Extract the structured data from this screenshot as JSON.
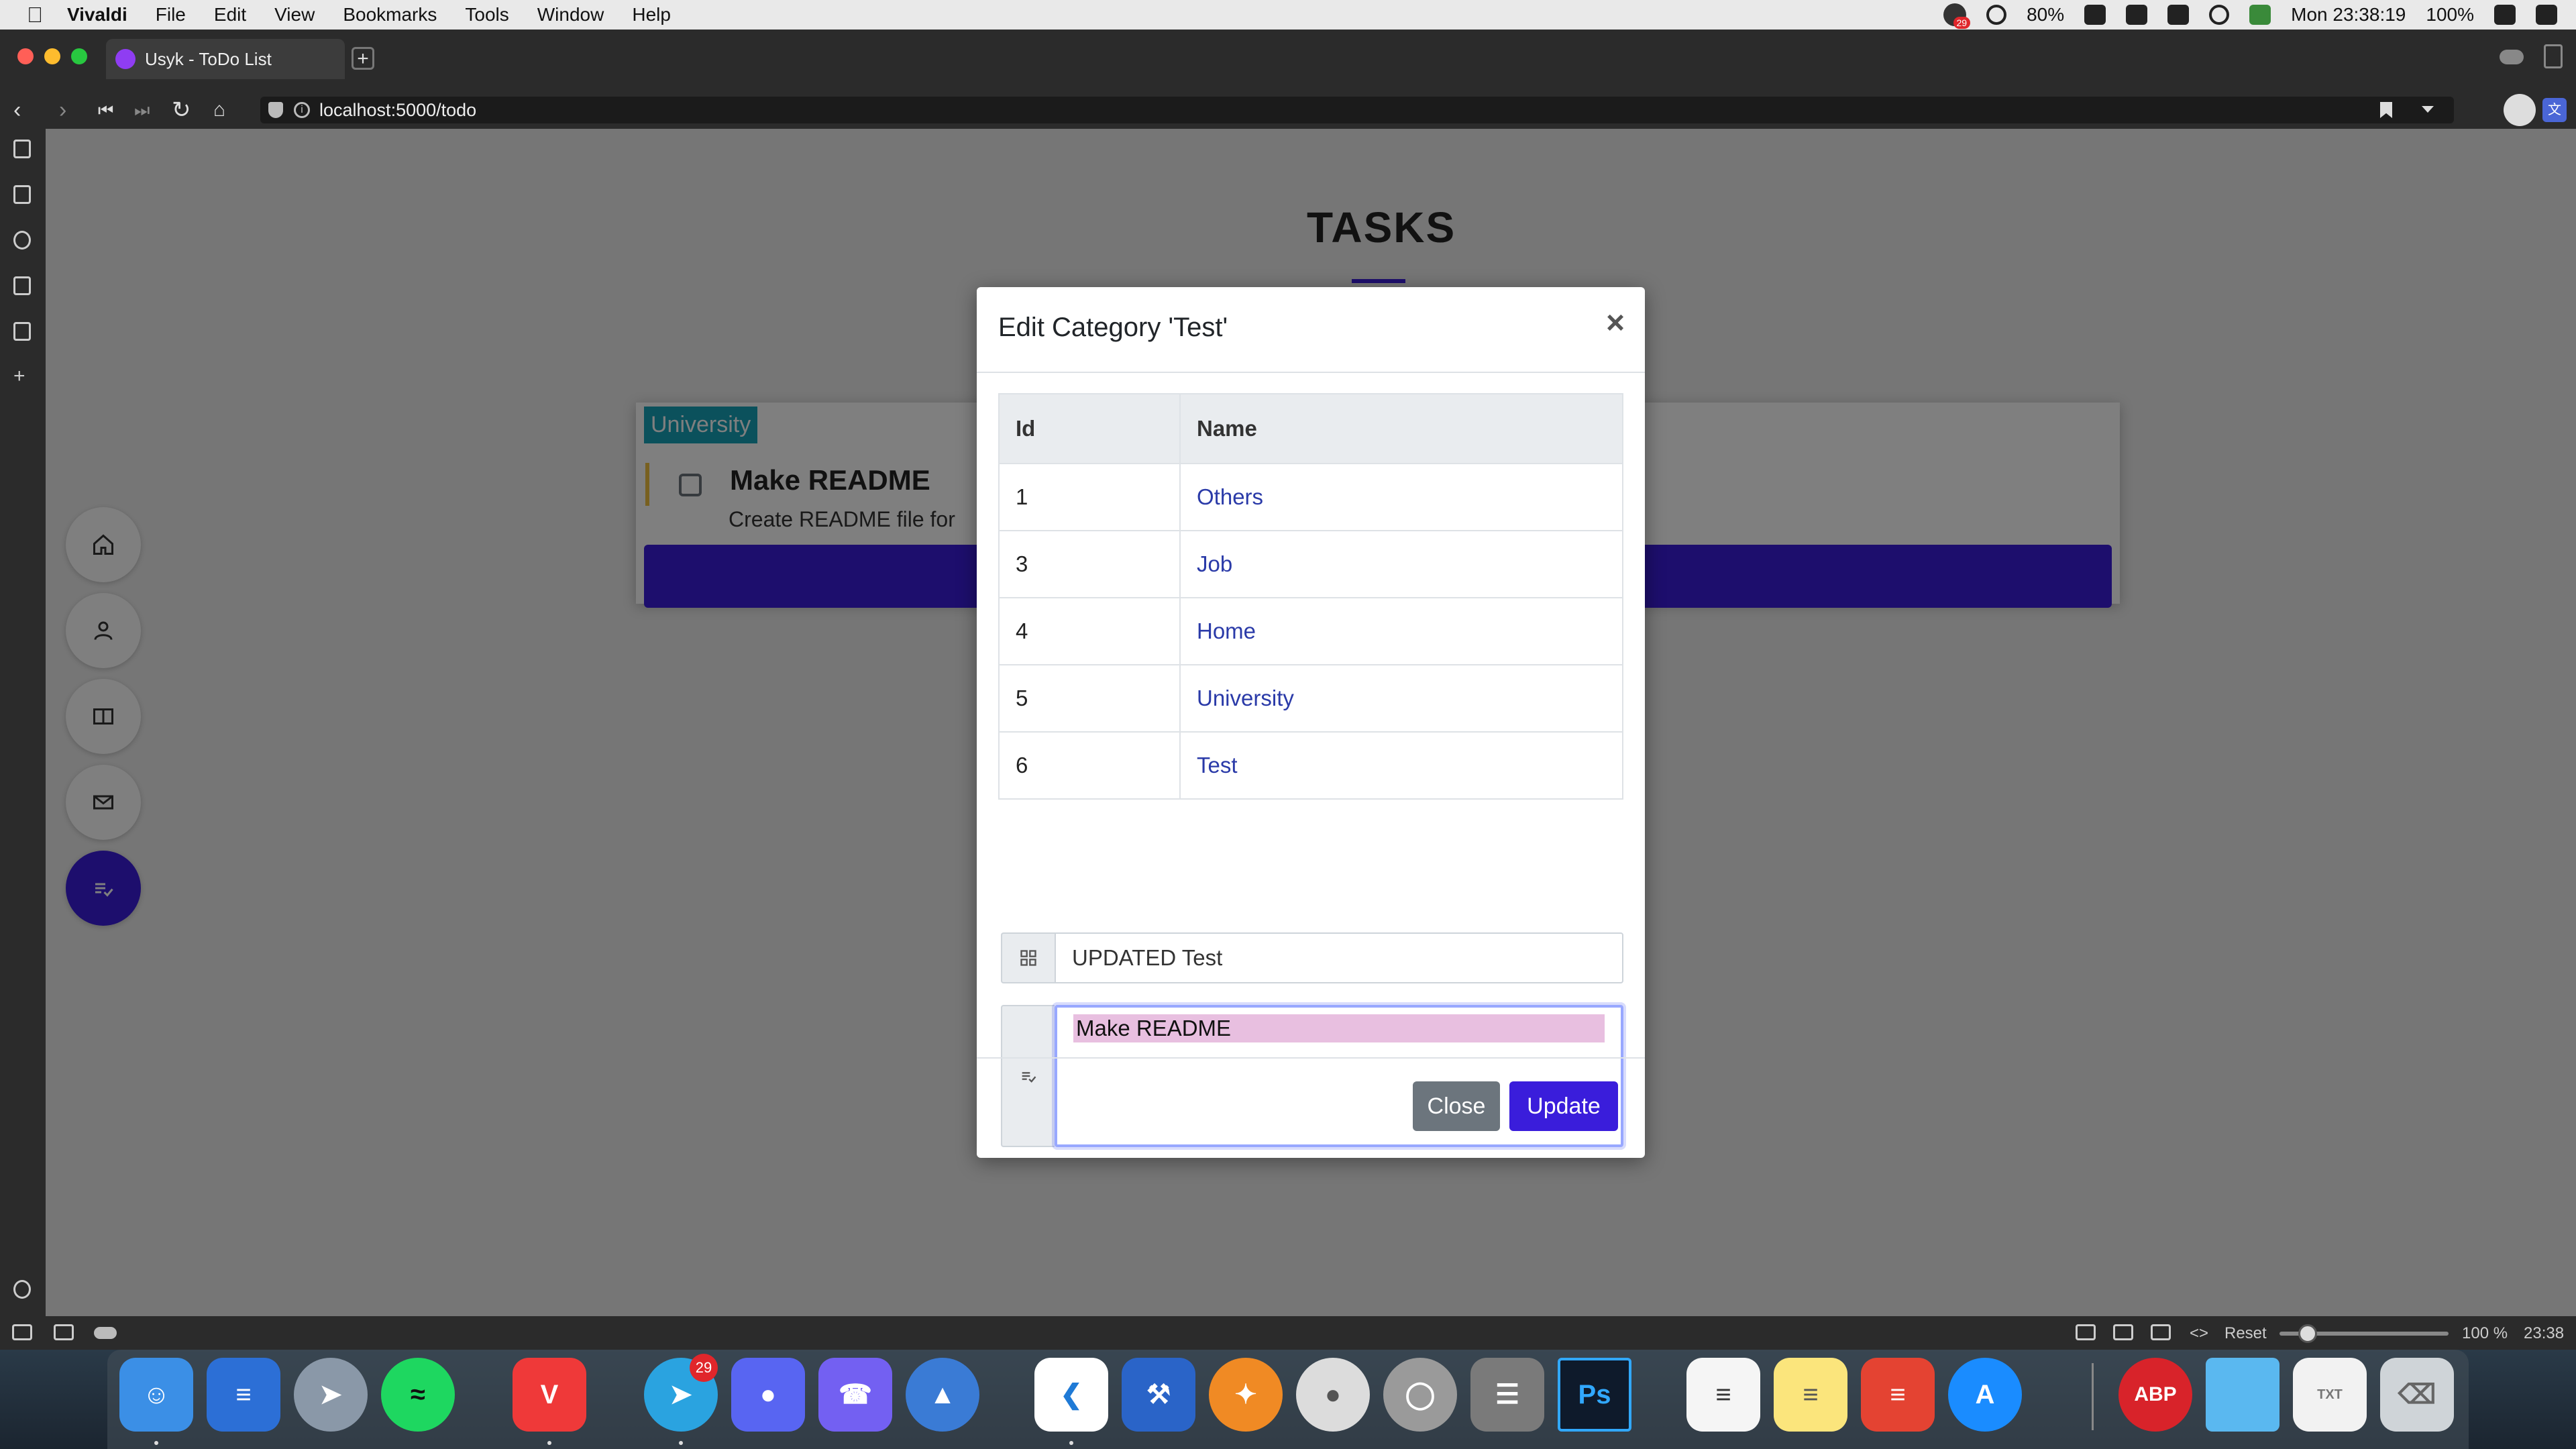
{
  "menubar": {
    "app_name": "Vivaldi",
    "items": [
      "File",
      "Edit",
      "View",
      "Bookmarks",
      "Tools",
      "Window",
      "Help"
    ],
    "notification_count": "29",
    "battery_ring": "80%",
    "battery_percent": "100%",
    "clock": "Mon 23:38:19"
  },
  "browser": {
    "tab_title": "Usyk - ToDo List",
    "url": "localhost:5000/todo",
    "status": {
      "reset_label": "Reset",
      "zoom_level": "100 %",
      "clock": "23:38"
    }
  },
  "page": {
    "title": "TASKS",
    "todo": {
      "category": "University",
      "title": "Make README",
      "description": "Create README file for"
    },
    "fabs": [
      "home-icon",
      "user-icon",
      "book-icon",
      "mail-icon",
      "tasks-icon"
    ]
  },
  "modal": {
    "title": "Edit Category 'Test'",
    "close_symbol": "×",
    "table": {
      "headers": [
        "Id",
        "Name"
      ],
      "rows": [
        {
          "id": "1",
          "name": "Others"
        },
        {
          "id": "3",
          "name": "Job"
        },
        {
          "id": "4",
          "name": "Home"
        },
        {
          "id": "5",
          "name": "University"
        },
        {
          "id": "6",
          "name": "Test"
        }
      ]
    },
    "name_input_value": "UPDATED Test",
    "textarea_value": "Make README",
    "close_button": "Close",
    "update_button": "Update"
  },
  "dock": {
    "telegram_badge": "29",
    "apps": [
      "Finder",
      "Outline",
      "Launchpad",
      "Spotify",
      "Vivaldi",
      "Telegram",
      "Discord",
      "Viber",
      "Copilot",
      "VS Code",
      "Xcode",
      "Swift Playgrounds",
      "TablePlus",
      "Disk Utility",
      "DB Browser",
      "Photoshop",
      "Reminders",
      "Notes",
      "Todoist",
      "App Store",
      "AdBlock Plus",
      "Folder",
      "TXT File",
      "Trash"
    ],
    "photoshop_label": "Ps",
    "abp_label": "ABP"
  },
  "colors": {
    "accent": "#3a1ddb",
    "badge_teal": "#17a2b8",
    "secondary": "#6c757d",
    "link": "#2a3aa8"
  }
}
